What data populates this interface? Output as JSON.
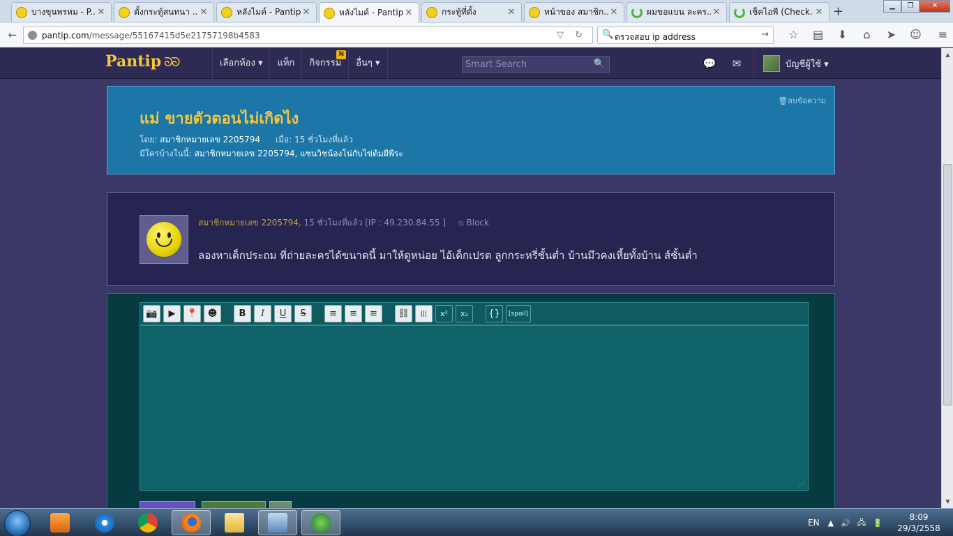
{
  "browser": {
    "tabs": [
      {
        "title": "บางขุนพรหม - P...",
        "favicon": "pantip-smiley-icon"
      },
      {
        "title": "ตั้งกระทู้สนทนา ...",
        "favicon": "pantip-smiley-icon"
      },
      {
        "title": "หลังไมค์ - Pantip",
        "favicon": "pantip-smiley-icon"
      },
      {
        "title": "หลังไมค์ - Pantip",
        "favicon": "pantip-smiley-icon",
        "active": true
      },
      {
        "title": "กระทู้ที่ตั้ง",
        "favicon": "pantip-smiley-icon"
      },
      {
        "title": "หน้าของ สมาชิก...",
        "favicon": "pantip-smiley-icon"
      },
      {
        "title": "ผมขอแบน ละคร...",
        "favicon": "loading-icon"
      },
      {
        "title": "เช็คไอพี (Check...",
        "favicon": "loading-icon"
      }
    ],
    "new_tab": "+",
    "url_host": "pantip.com",
    "url_path": "/message/55167415d5e21757198b4583",
    "search_query": "ตรวจสอบ ip address"
  },
  "header": {
    "logo": "Pantip",
    "logo_swirl": "ᘐᘐ",
    "menu": [
      {
        "label": "เลือกห้อง ▾"
      },
      {
        "label": "แท็ก"
      },
      {
        "label": "กิจกรรม",
        "badge": "N"
      },
      {
        "label": "อื่นๆ ▾"
      }
    ],
    "search_placeholder": "Smart Search",
    "account_label": "บัญชีผู้ใช้ ▾"
  },
  "thread": {
    "delete_label": "🗑ลบข้อความ",
    "title": "แม่ ขายตัวตอนไม่เกิดไง",
    "by_prefix": "โดย:",
    "by_user": "สมาชิกหมายเลข 2205794",
    "when_prefix": "เมื่อ:",
    "when_value": "15 ชั่วโมงที่แล้ว",
    "participants_prefix": "มีใครบ้างในนี้:",
    "participants": "สมาชิกหมายเลข 2205794, แซนวิชน้องโน่กับไข่ต้มผีพีระ"
  },
  "message": {
    "author": "สมาชิกหมายเลข 2205794",
    "time_ip": ", 15 ชั่วโมงที่แล้ว [IP : 49.230.84.55 ]",
    "block_label": "⦸ Block",
    "body": "ลองหาเด็กประถม ที่ถ่ายละครได้ขนาดนี้ มาให้ดูหน่อย ไอ้เด็กเปรต ลูกกระหรี่ชั้นต่ำ บ้านมึวคงเหี้ยทั้งบ้าน ส์ชั้นต่ำ"
  },
  "editor": {
    "tools": [
      {
        "name": "camera",
        "glyph": "📷"
      },
      {
        "name": "video",
        "glyph": "▶"
      },
      {
        "name": "map-pin",
        "glyph": "📍"
      },
      {
        "name": "emoticon",
        "glyph": "☻"
      },
      {
        "name": "bold",
        "glyph": "B"
      },
      {
        "name": "italic",
        "glyph": "I"
      },
      {
        "name": "underline",
        "glyph": "U"
      },
      {
        "name": "strikethrough",
        "glyph": "S"
      },
      {
        "name": "align-left",
        "glyph": "≡"
      },
      {
        "name": "align-center",
        "glyph": "≡"
      },
      {
        "name": "align-right",
        "glyph": "≡"
      },
      {
        "name": "link",
        "glyph": "⛓"
      },
      {
        "name": "hr",
        "glyph": "|||"
      },
      {
        "name": "superscript",
        "glyph": "x²"
      },
      {
        "name": "subscript",
        "glyph": "x₂"
      },
      {
        "name": "code",
        "glyph": "{}"
      },
      {
        "name": "spoil",
        "glyph": "[spoil]"
      }
    ]
  },
  "taskbar": {
    "language": "EN",
    "time": "8:09",
    "date": "29/3/2558"
  },
  "colors": {
    "pantip_yellow": "#f4c63a",
    "page_bg": "#3b3868",
    "title_box": "#1c76a7",
    "editor_bg": "#063c41"
  }
}
